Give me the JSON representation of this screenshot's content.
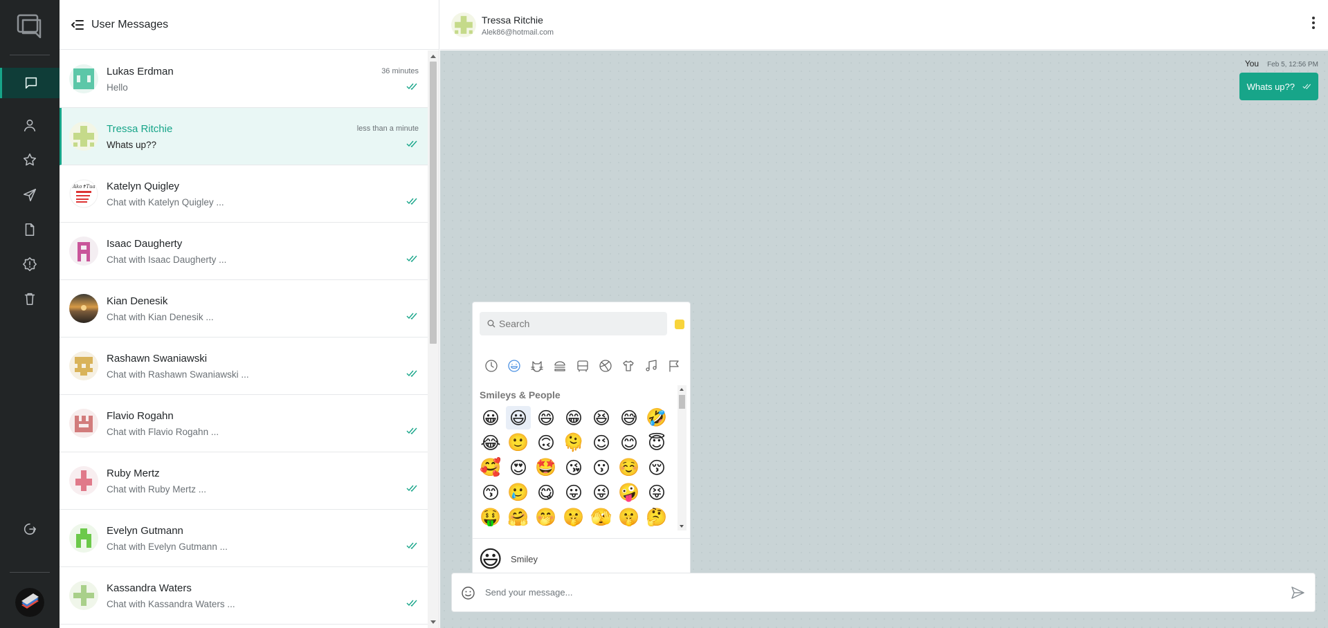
{
  "app": {
    "accent": "#17a589",
    "rail_bg": "#222526"
  },
  "rail": {
    "items": [
      {
        "icon": "chat-icon",
        "active": true
      },
      {
        "icon": "user-icon"
      },
      {
        "icon": "star-icon"
      },
      {
        "icon": "send-icon"
      },
      {
        "icon": "file-icon"
      },
      {
        "icon": "alert-icon"
      },
      {
        "icon": "trash-icon"
      }
    ],
    "logout_icon": "logout-icon"
  },
  "sidebar": {
    "title": "User Messages",
    "conversations": [
      {
        "name": "Lukas Erdman",
        "preview": "Hello",
        "time": "36 minutes"
      },
      {
        "name": "Tressa Ritchie",
        "preview": "Whats up??",
        "time": "less than a minute",
        "active": true
      },
      {
        "name": "Katelyn Quigley",
        "preview": "Chat with Katelyn Quigley ...",
        "time": ""
      },
      {
        "name": "Isaac Daugherty",
        "preview": "Chat with Isaac Daugherty ...",
        "time": ""
      },
      {
        "name": "Kian Denesik",
        "preview": "Chat with Kian Denesik ...",
        "time": ""
      },
      {
        "name": "Rashawn Swaniawski",
        "preview": "Chat with Rashawn Swaniawski ...",
        "time": ""
      },
      {
        "name": "Flavio Rogahn",
        "preview": "Chat with Flavio Rogahn ...",
        "time": ""
      },
      {
        "name": "Ruby Mertz",
        "preview": "Chat with Ruby Mertz ...",
        "time": ""
      },
      {
        "name": "Evelyn Gutmann",
        "preview": "Chat with Evelyn Gutmann ...",
        "time": ""
      },
      {
        "name": "Kassandra Waters",
        "preview": "Chat with Kassandra Waters ...",
        "time": ""
      }
    ]
  },
  "chat": {
    "contact_name": "Tressa Ritchie",
    "contact_email": "Alek86@hotmail.com",
    "messages": [
      {
        "sender": "You",
        "date": "Feb 5, 12:56 PM",
        "text": "Whats up??"
      }
    ]
  },
  "emoji_picker": {
    "search_placeholder": "Search",
    "section_title": "Smileys & People",
    "emojis": [
      "😀",
      "😃",
      "😄",
      "😁",
      "😆",
      "😅",
      "🤣",
      "😂",
      "🙂",
      "🙃",
      "🫠",
      "😉",
      "😊",
      "😇",
      "🥰",
      "😍",
      "🤩",
      "😘",
      "😗",
      "☺️",
      "😚",
      "😙",
      "🥲",
      "😋",
      "😛",
      "😜",
      "🤪",
      "😝",
      "🤑",
      "🤗",
      "🤭",
      "🤫",
      "🫣",
      "🤫",
      "🤔",
      "🤐",
      "🤨",
      "😐",
      "😑",
      "😶",
      "🫡",
      "😏"
    ],
    "selected_index": 1,
    "preview_emoji": "😃",
    "preview_name": "Smiley"
  },
  "composer": {
    "placeholder": "Send your message..."
  }
}
